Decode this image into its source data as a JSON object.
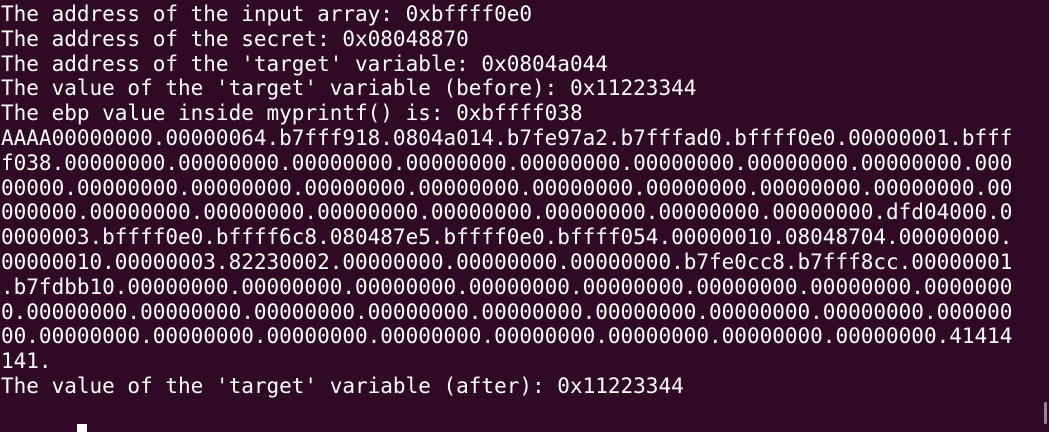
{
  "terminal": {
    "lines": [
      "The address of the input array: 0xbffff0e0",
      "The address of the secret: 0x08048870",
      "The address of the 'target' variable: 0x0804a044",
      "The value of the 'target' variable (before): 0x11223344",
      "The ebp value inside myprintf() is: 0xbffff038",
      "AAAA00000000.00000064.b7fff918.0804a014.b7fe97a2.b7fffad0.bffff0e0.00000001.bfff",
      "f038.00000000.00000000.00000000.00000000.00000000.00000000.00000000.00000000.000",
      "00000.00000000.00000000.00000000.00000000.00000000.00000000.00000000.00000000.00",
      "000000.00000000.00000000.00000000.00000000.00000000.00000000.00000000.dfd04000.0",
      "0000003.bffff0e0.bffff6c8.080487e5.bffff0e0.bffff054.00000010.08048704.00000000.",
      "00000010.00000003.82230002.00000000.00000000.00000000.b7fe0cc8.b7fff8cc.00000001",
      ".b7fdbb10.00000000.00000000.00000000.00000000.00000000.00000000.00000000.0000000",
      "0.00000000.00000000.00000000.00000000.00000000.00000000.00000000.00000000.000000",
      "00.00000000.00000000.00000000.00000000.00000000.00000000.00000000.00000000.41414",
      "141.",
      "The value of the 'target' variable (after): 0x11223344"
    ]
  },
  "colors": {
    "background": "#300a24",
    "text": "#ffffff",
    "cursor": "#ffffff"
  }
}
